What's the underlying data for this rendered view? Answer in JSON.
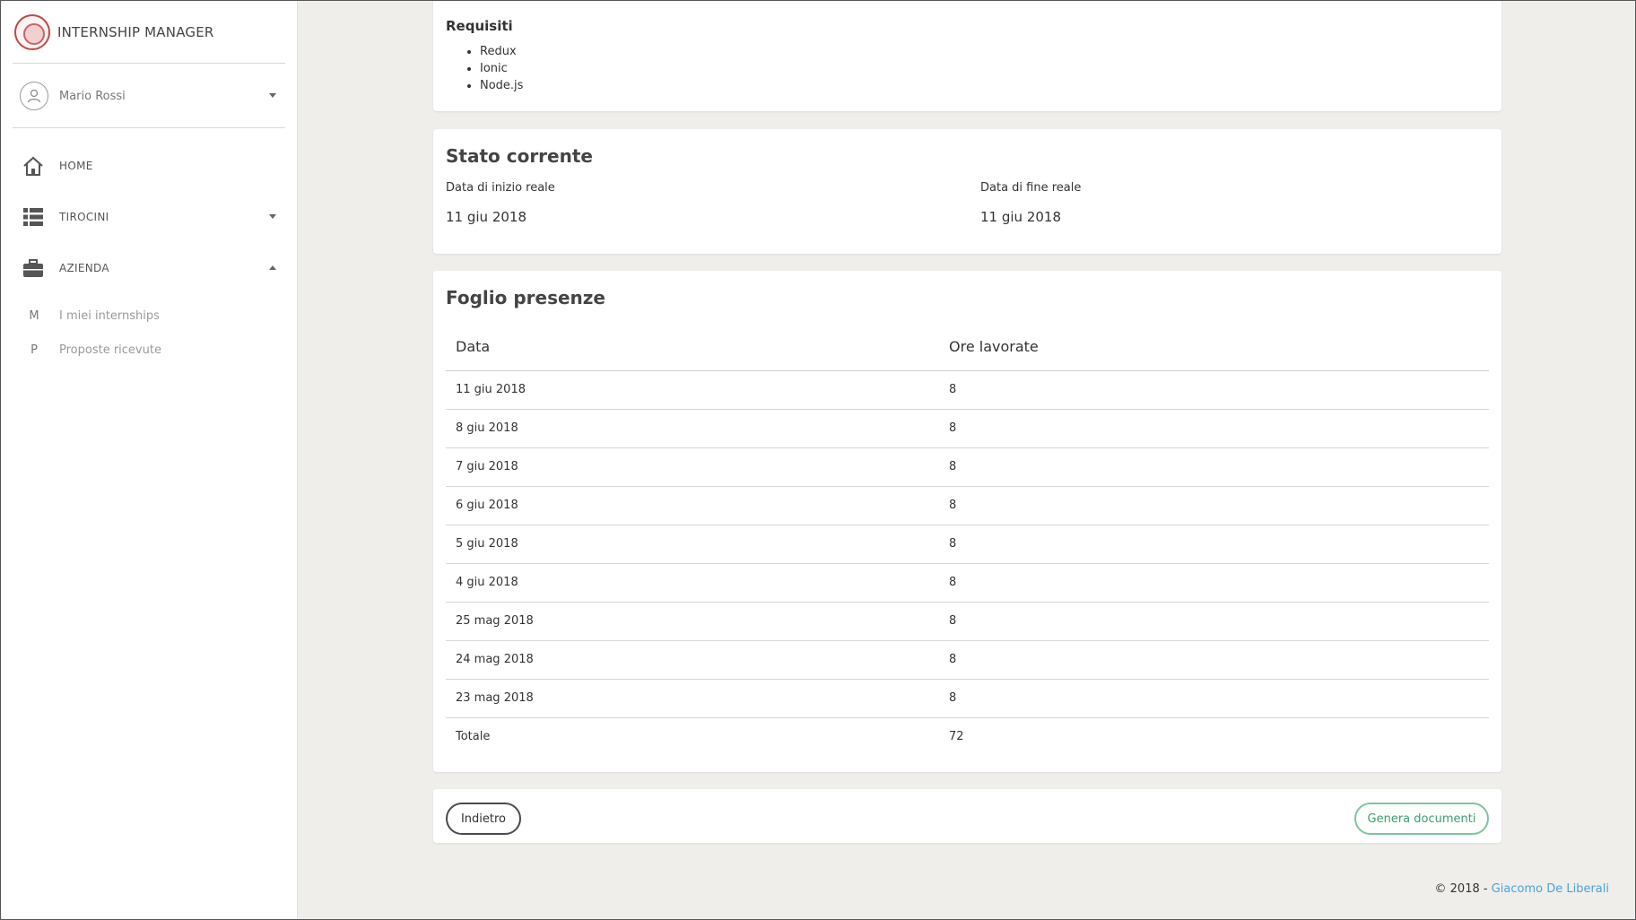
{
  "app": {
    "title": "INTERNSHIP MANAGER"
  },
  "user": {
    "name": "Mario Rossi"
  },
  "sidebar": {
    "items": [
      {
        "label": "HOME",
        "icon": "home-icon"
      },
      {
        "label": "TIROCINI",
        "icon": "list-icon"
      },
      {
        "label": "AZIENDA",
        "icon": "briefcase-icon"
      }
    ],
    "subitems": [
      {
        "letter": "M",
        "label": "I miei internships"
      },
      {
        "letter": "P",
        "label": "Proposte ricevute"
      }
    ]
  },
  "requirements": {
    "title": "Requisiti",
    "items": [
      "Redux",
      "Ionic",
      "Node.js"
    ]
  },
  "status": {
    "title": "Stato corrente",
    "start_label": "Data di inizio reale",
    "start_value": "11 giu 2018",
    "end_label": "Data di fine reale",
    "end_value": "11 giu 2018"
  },
  "attendance": {
    "title": "Foglio presenze",
    "headers": [
      "Data",
      "Ore lavorate"
    ],
    "rows": [
      [
        "11 giu 2018",
        "8"
      ],
      [
        "8 giu 2018",
        "8"
      ],
      [
        "7 giu 2018",
        "8"
      ],
      [
        "6 giu 2018",
        "8"
      ],
      [
        "5 giu 2018",
        "8"
      ],
      [
        "4 giu 2018",
        "8"
      ],
      [
        "25 mag 2018",
        "8"
      ],
      [
        "24 mag 2018",
        "8"
      ],
      [
        "23 mag 2018",
        "8"
      ]
    ],
    "total_label": "Totale",
    "total_value": "72"
  },
  "actions": {
    "back_label": "Indietro",
    "generate_label": "Genera documenti"
  },
  "footer": {
    "copyright": "© 2018 - ",
    "author": "Giacomo De Liberali"
  },
  "colors": {
    "background": "#efeeeb",
    "accent_green": "#3aa06f",
    "link_blue": "#4aa3d8"
  }
}
